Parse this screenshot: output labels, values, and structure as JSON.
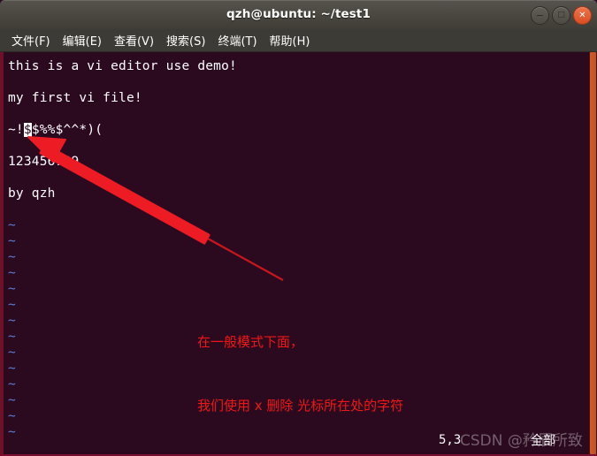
{
  "window": {
    "title": "qzh@ubuntu: ~/test1",
    "buttons": [
      {
        "name": "minimize",
        "glyph": "−"
      },
      {
        "name": "maximize",
        "glyph": "□"
      },
      {
        "name": "close",
        "glyph": "✕"
      }
    ]
  },
  "menubar": {
    "items": [
      {
        "label": "文件(F)"
      },
      {
        "label": "编辑(E)"
      },
      {
        "label": "查看(V)"
      },
      {
        "label": "搜索(S)"
      },
      {
        "label": "终端(T)"
      },
      {
        "label": "帮助(H)"
      }
    ]
  },
  "editor": {
    "lines": [
      {
        "text": "this is a vi editor use demo!",
        "type": "text"
      },
      {
        "text": "",
        "type": "blank"
      },
      {
        "text": "my first vi file!",
        "type": "text"
      },
      {
        "text": "",
        "type": "blank"
      },
      {
        "text": "~!$$%%$^^*)(",
        "type": "cursor-line",
        "cursor_index": 2
      },
      {
        "text": "",
        "type": "blank"
      },
      {
        "text": "123456789",
        "type": "text"
      },
      {
        "text": "",
        "type": "blank"
      },
      {
        "text": "by qzh",
        "type": "text"
      }
    ],
    "cursor_line_parts": {
      "before": "~!",
      "cursor": "$",
      "after": "$%%$^^*)("
    },
    "tilde_count": 14,
    "tilde_char": "~",
    "colors": {
      "background": "#2b0a20",
      "foreground": "#ffffff",
      "tilde": "#5a7fd6",
      "cursor_bg": "#ffffff",
      "scrollbar": "#c95620",
      "border": "#7b1030",
      "annotation": "#f01616"
    }
  },
  "annotation": {
    "line1": "在一般模式下面，",
    "line2": "我们使用 x 删除 光标所在处的字符"
  },
  "status": {
    "position": "5,3",
    "scroll": "全部"
  },
  "watermark": {
    "text": "CSDN @矜辰所致"
  }
}
